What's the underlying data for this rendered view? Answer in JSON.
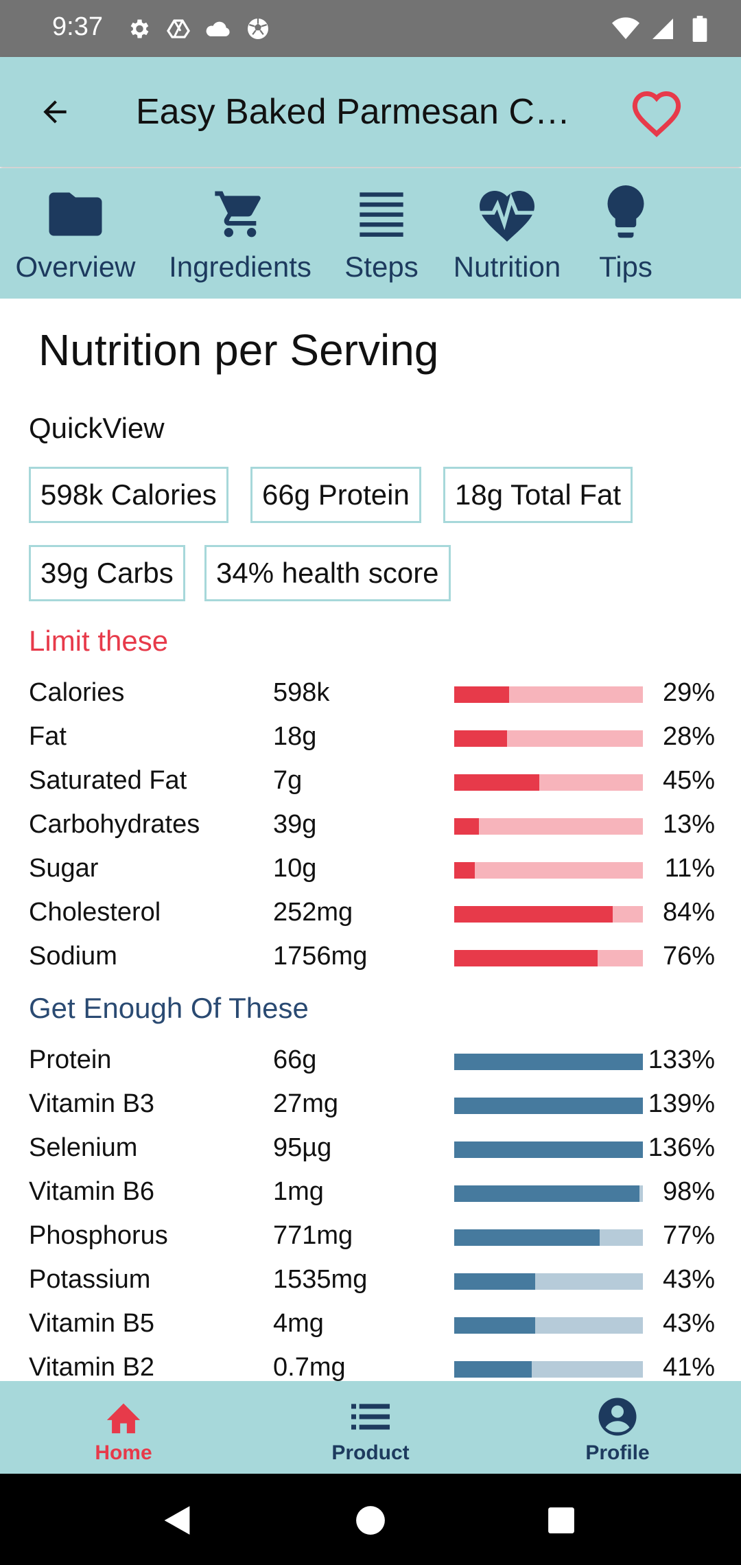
{
  "status_bar": {
    "time": "9:37",
    "left_icons": [
      "gear-icon",
      "drive-icon",
      "cloud-icon",
      "soccer-icon"
    ],
    "right_icons": [
      "wifi-icon",
      "signal-icon",
      "battery-icon"
    ]
  },
  "app_bar": {
    "title": "Easy Baked Parmesan C…",
    "back_icon": "arrow-left-icon",
    "favorite_icon": "heart-outline-icon",
    "favorite_color": "#e73a4a"
  },
  "tabs": [
    {
      "label": "Overview",
      "icon": "folder-icon"
    },
    {
      "label": "Ingredients",
      "icon": "cart-icon"
    },
    {
      "label": "Steps",
      "icon": "lines-icon"
    },
    {
      "label": "Nutrition",
      "icon": "heart-pulse-icon"
    },
    {
      "label": "Tips",
      "icon": "lightbulb-icon"
    }
  ],
  "page": {
    "title": "Nutrition per Serving",
    "quickview_label": "QuickView",
    "chips": [
      "598k Calories",
      "66g Protein",
      "18g Total Fat",
      "39g Carbs",
      "34% health score"
    ]
  },
  "limit": {
    "title": "Limit these",
    "color": "#e73a4a",
    "rows": [
      {
        "name": "Calories",
        "amount": "598k",
        "percent": "29%",
        "value": 29
      },
      {
        "name": "Fat",
        "amount": "18g",
        "percent": "28%",
        "value": 28
      },
      {
        "name": "Saturated Fat",
        "amount": "7g",
        "percent": "45%",
        "value": 45
      },
      {
        "name": "Carbohydrates",
        "amount": "39g",
        "percent": "13%",
        "value": 13
      },
      {
        "name": "Sugar",
        "amount": "10g",
        "percent": "11%",
        "value": 11
      },
      {
        "name": "Cholesterol",
        "amount": "252mg",
        "percent": "84%",
        "value": 84
      },
      {
        "name": "Sodium",
        "amount": "1756mg",
        "percent": "76%",
        "value": 76
      }
    ]
  },
  "enough": {
    "title": "Get Enough Of These",
    "color": "#2a4a72",
    "rows": [
      {
        "name": "Protein",
        "amount": "66g",
        "percent": "133%",
        "value": 133
      },
      {
        "name": "Vitamin B3",
        "amount": "27mg",
        "percent": "139%",
        "value": 139
      },
      {
        "name": "Selenium",
        "amount": "95µg",
        "percent": "136%",
        "value": 136
      },
      {
        "name": "Vitamin B6",
        "amount": "1mg",
        "percent": "98%",
        "value": 98
      },
      {
        "name": "Phosphorus",
        "amount": "771mg",
        "percent": "77%",
        "value": 77
      },
      {
        "name": "Potassium",
        "amount": "1535mg",
        "percent": "43%",
        "value": 43
      },
      {
        "name": "Vitamin B5",
        "amount": "4mg",
        "percent": "43%",
        "value": 43
      },
      {
        "name": "Vitamin B2",
        "amount": "0.7mg",
        "percent": "41%",
        "value": 41
      }
    ]
  },
  "bottom_nav": {
    "active_color": "#e73a4a",
    "inactive_color": "#1d3a5e",
    "items": [
      {
        "label": "Home",
        "icon": "home-icon",
        "active": true
      },
      {
        "label": "Product",
        "icon": "list-icon",
        "active": false
      },
      {
        "label": "Profile",
        "icon": "account-circle-icon",
        "active": false
      }
    ]
  },
  "system_nav": [
    "back-triangle-icon",
    "home-circle-icon",
    "recents-square-icon"
  ]
}
